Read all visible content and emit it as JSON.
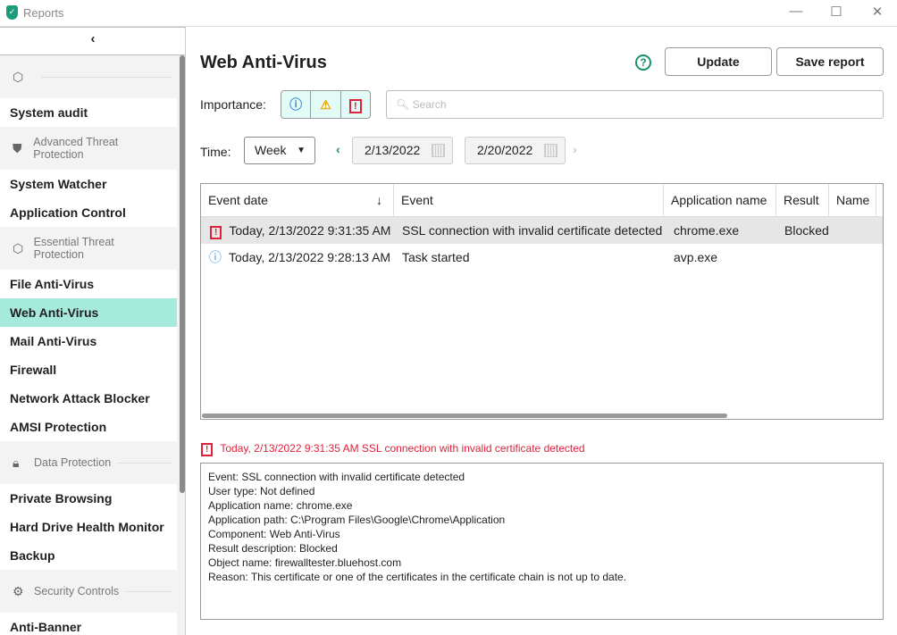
{
  "window": {
    "title": "Reports",
    "minimize": "—",
    "maximize": "☐",
    "close": "✕"
  },
  "sidebar": {
    "collapse": "‹",
    "groups": [
      {
        "label": "",
        "items": [
          "System audit"
        ]
      },
      {
        "label": "Advanced Threat Protection",
        "items": [
          "System Watcher",
          "Application Control"
        ]
      },
      {
        "label": "Essential Threat Protection",
        "items": [
          "File Anti-Virus",
          "Web Anti-Virus",
          "Mail Anti-Virus",
          "Firewall",
          "Network Attack Blocker",
          "AMSI Protection"
        ]
      },
      {
        "label": "Data Protection",
        "items": [
          "Private Browsing",
          "Hard Drive Health Monitor",
          "Backup"
        ]
      },
      {
        "label": "Security Controls",
        "items": [
          "Anti-Banner"
        ]
      }
    ],
    "active": "Web Anti-Virus"
  },
  "main": {
    "title": "Web Anti-Virus",
    "help": "?",
    "update": "Update",
    "save": "Save report",
    "importance_label": "Importance:",
    "search_placeholder": "Search",
    "time_label": "Time:",
    "period": "Week",
    "date_from": "2/13/2022",
    "date_to": "2/20/2022"
  },
  "table": {
    "columns": [
      "Event date",
      "Event",
      "Application name",
      "Result",
      "Name"
    ],
    "rows": [
      {
        "level": "critical",
        "date": "Today, 2/13/2022 9:31:35 AM",
        "event": "SSL connection with invalid certificate detected",
        "app": "chrome.exe",
        "result": "Blocked",
        "name": ""
      },
      {
        "level": "info",
        "date": "Today, 2/13/2022 9:28:13 AM",
        "event": "Task started",
        "app": "avp.exe",
        "result": "",
        "name": ""
      }
    ]
  },
  "details": {
    "header": "Today, 2/13/2022 9:31:35 AM SSL connection with invalid certificate detected",
    "lines": [
      "Event: SSL connection with invalid certificate detected",
      "User type: Not defined",
      "Application name: chrome.exe",
      "Application path: C:\\Program Files\\Google\\Chrome\\Application",
      "Component: Web Anti-Virus",
      "Result description: Blocked",
      "Object name: firewalltester.bluehost.com",
      "Reason: This certificate or one of the certificates in the certificate chain is not up to date."
    ]
  },
  "colors": {
    "accent": "#1a9c7c",
    "active": "#a6eadc",
    "error": "#e0213a"
  }
}
